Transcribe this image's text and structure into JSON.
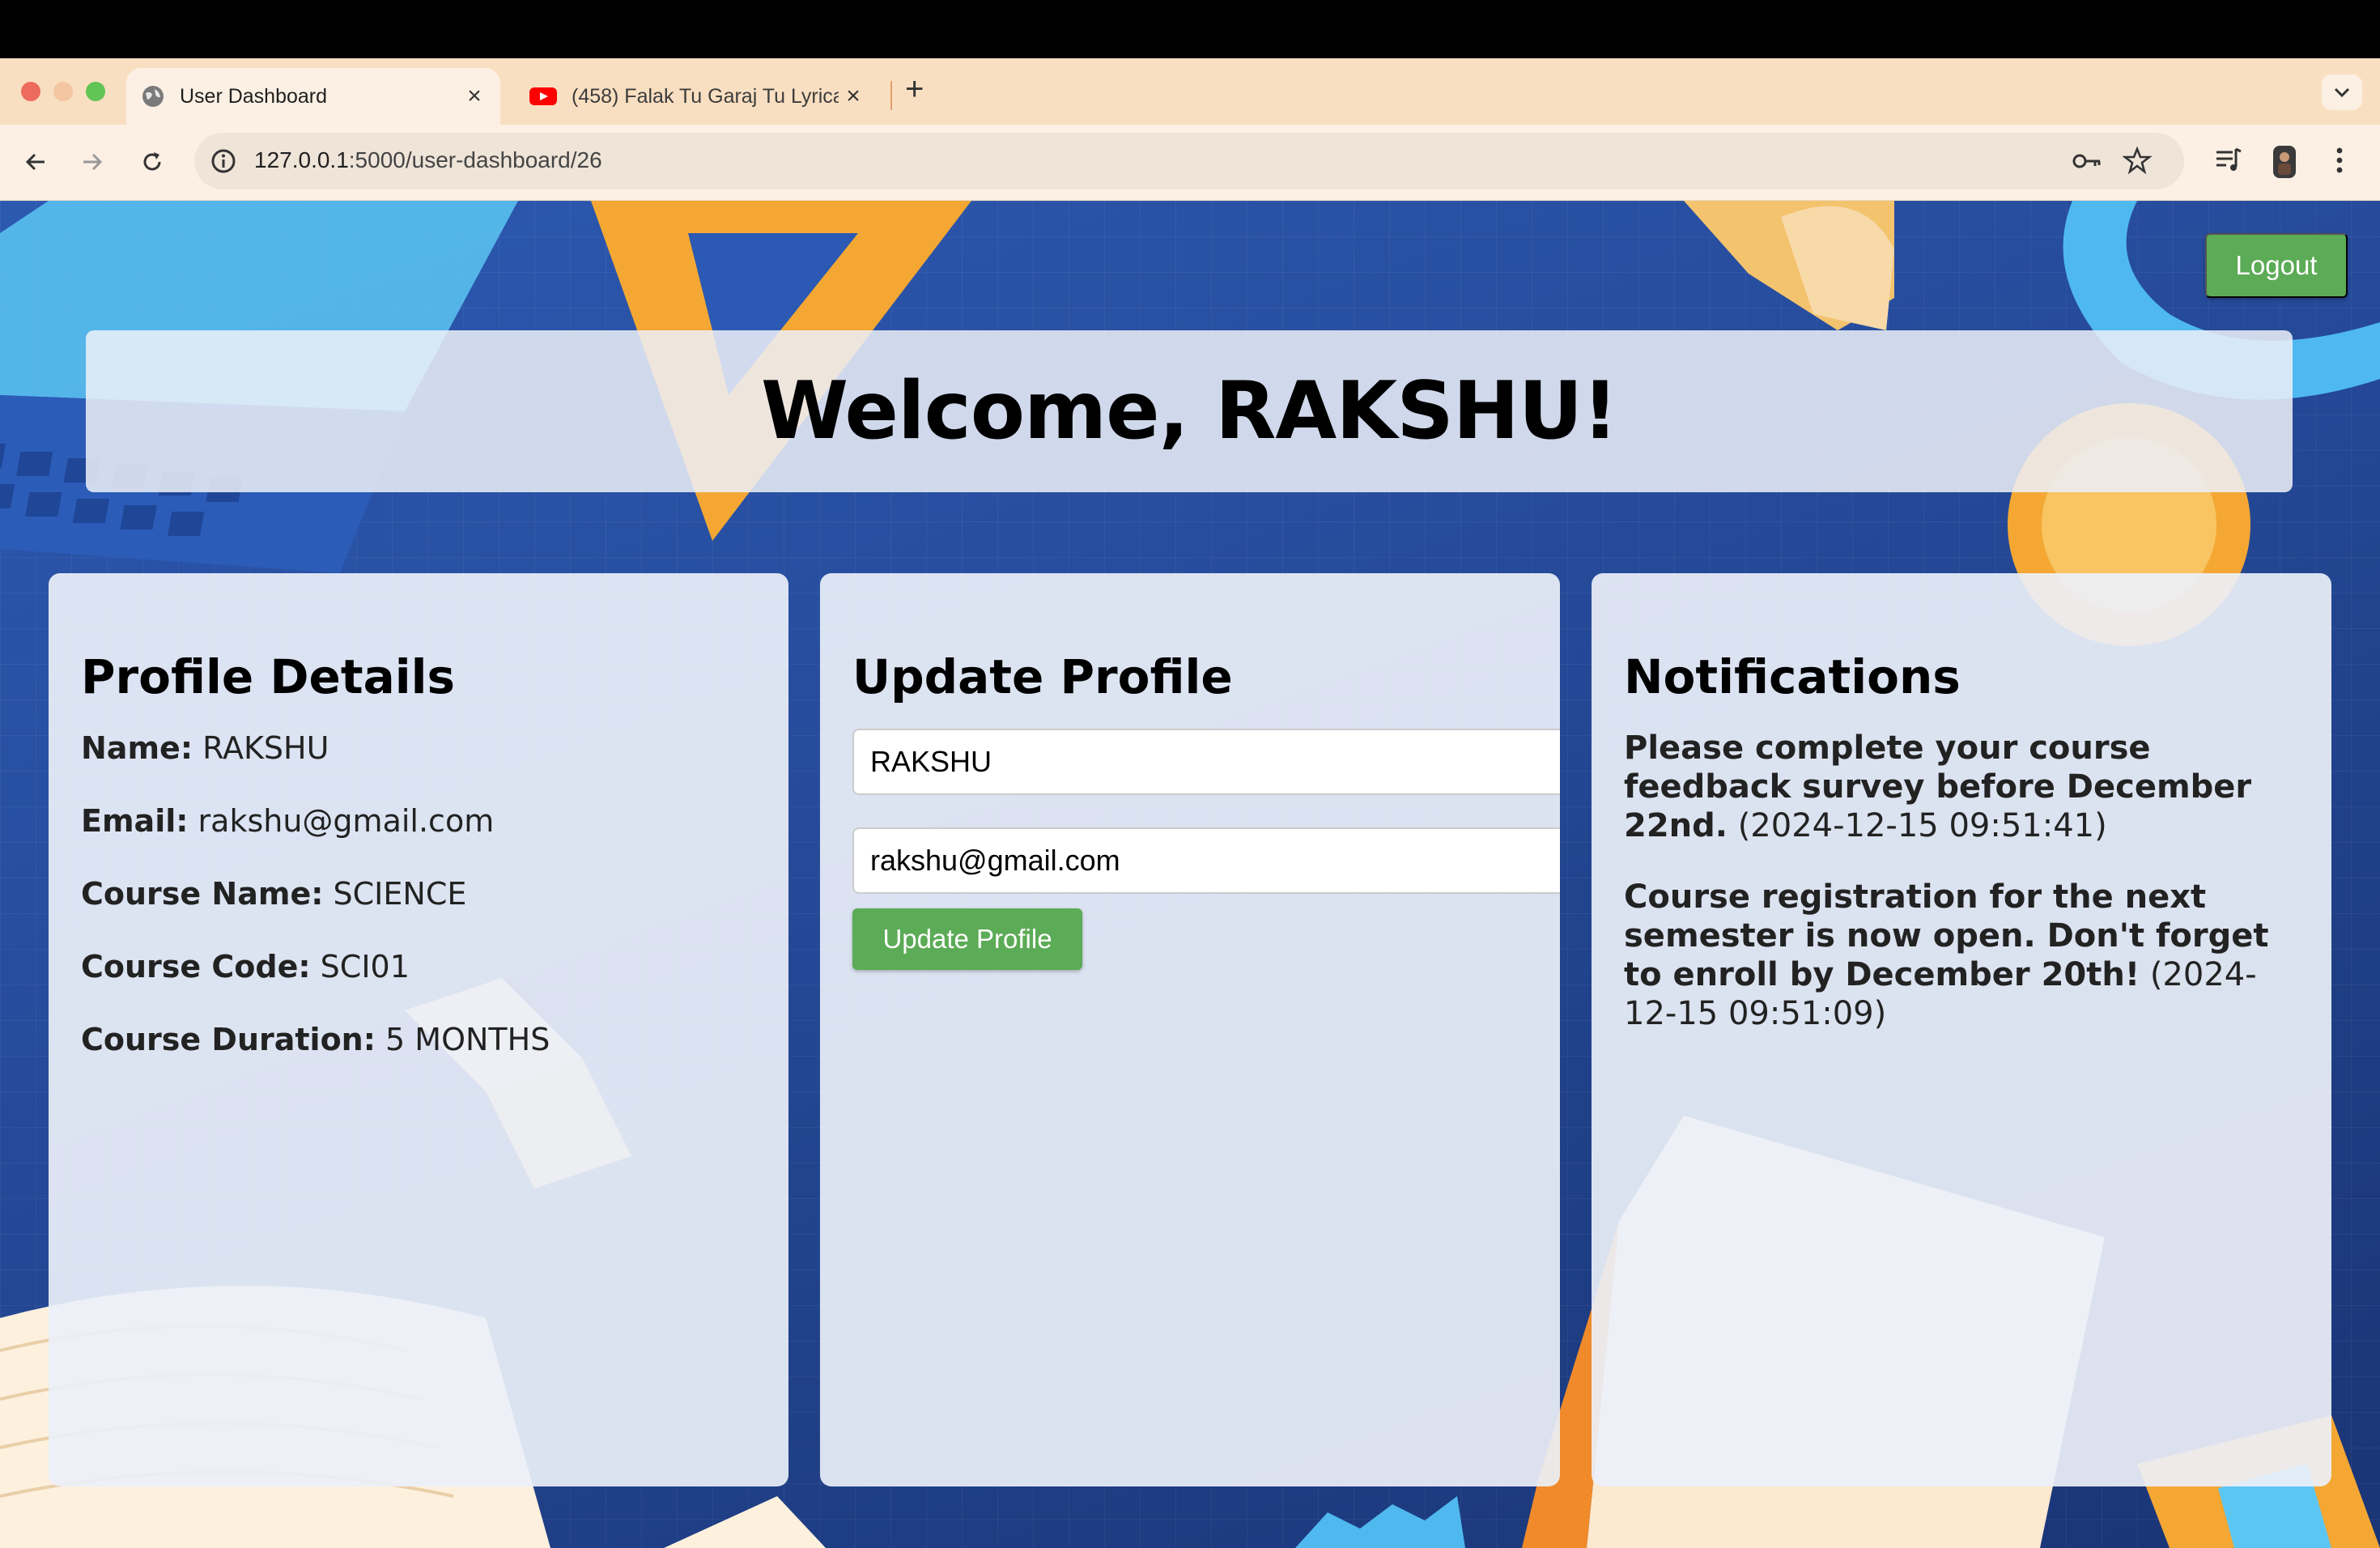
{
  "browser": {
    "tabs": [
      {
        "title": "User Dashboard",
        "icon": "globe-icon",
        "active": true
      },
      {
        "title": "(458) Falak Tu Garaj Tu Lyrica",
        "icon": "youtube-icon",
        "active": false
      }
    ],
    "url_host": "127.0.0.1",
    "url_path": ":5000/user-dashboard/26"
  },
  "page": {
    "logout_label": "Logout",
    "welcome": "Welcome, RAKSHU!"
  },
  "profile": {
    "heading": "Profile Details",
    "name_label": "Name:",
    "name_value": "RAKSHU",
    "email_label": "Email:",
    "email_value": "rakshu@gmail.com",
    "course_name_label": "Course Name:",
    "course_name_value": "SCIENCE",
    "course_code_label": "Course Code:",
    "course_code_value": "SCI01",
    "course_duration_label": "Course Duration:",
    "course_duration_value": "5 MONTHS"
  },
  "update": {
    "heading": "Update Profile",
    "name_value": "RAKSHU",
    "email_value": "rakshu@gmail.com",
    "button_label": "Update Profile"
  },
  "notifications": {
    "heading": "Notifications",
    "items": [
      {
        "message": "Please complete your course feedback survey before December 22nd.",
        "timestamp": "(2024-12-15 09:51:41)"
      },
      {
        "message": "Course registration for the next semester is now open. Don't forget to enroll by December 20th!",
        "timestamp": "(2024-12-15 09:51:09)"
      }
    ]
  },
  "colors": {
    "accent_green": "#5cab56",
    "page_blue": "#274d9e",
    "tabstrip": "#f9dfc1"
  }
}
